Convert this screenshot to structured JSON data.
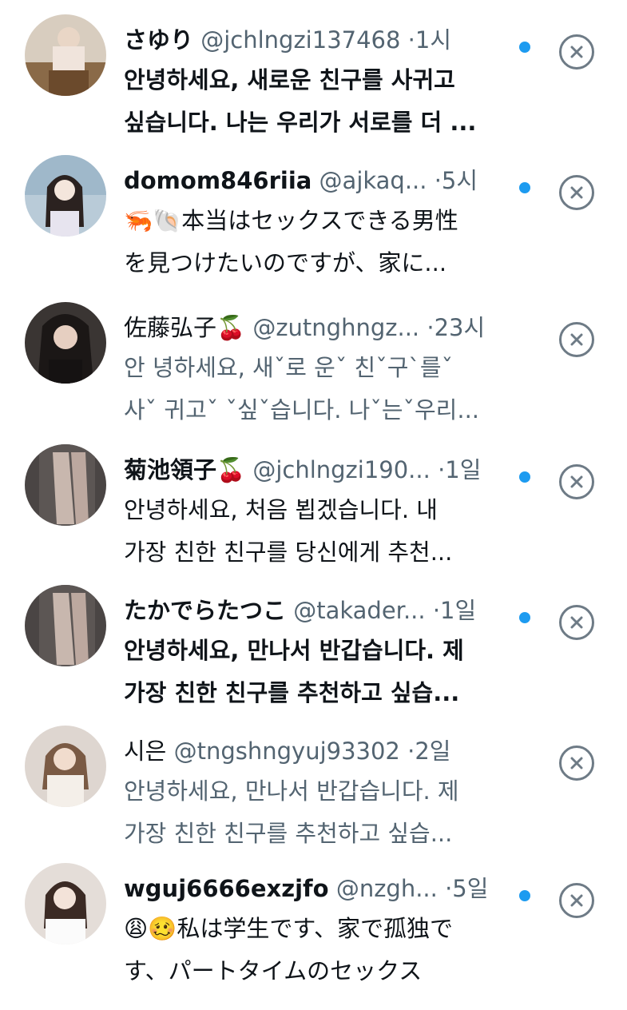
{
  "messages": [
    {
      "name": "さゆり",
      "handle": "@jchlngzi137468",
      "time": "·1시",
      "line1": "안녕하세요, 새로운 친구를 사귀고",
      "line2": "싶습니다. 나는 우리가 서로를 더 ...",
      "unread": true,
      "avatar": "avatar-photo"
    },
    {
      "name": "domom846riia",
      "handle": "@ajkaq...",
      "time": "·5시",
      "line1": "🦐🐚本当はセックスできる男性",
      "line2": "を見つけたいのですが、家に...",
      "unread": true,
      "avatar": "avatar-photo"
    },
    {
      "name": "佐藤弘子🍒",
      "handle": "@zutnghngz...",
      "time": "·23시",
      "line1": "안  녕하세요, 새ˇ로  운ˇ 친ˇ구ˋ를ˇ",
      "line2": "사ˇ 귀고ˇ ˇ싶ˇ습니다. 나ˇ는ˇ우리...",
      "unread": false,
      "avatar": "avatar-photo"
    },
    {
      "name": "菊池領子🍒",
      "handle": "@jchlngzi190...",
      "time": "·1일",
      "line1": "안녕하세요, 처음 뵙겠습니다. 내",
      "line2": "가장 친한 친구를 당신에게 추천...",
      "unread": true,
      "avatar": "avatar-photo"
    },
    {
      "name": "たかでらたつこ",
      "handle": "@takader...",
      "time": "·1일",
      "line1": "안녕하세요, 만나서 반갑습니다. 제",
      "line2": "가장 친한 친구를 추천하고 싶습...",
      "unread": true,
      "avatar": "avatar-photo"
    },
    {
      "name": "시은",
      "handle": "@tngshngyuj93302",
      "time": "·2일",
      "line1": "안녕하세요, 만나서 반갑습니다. 제",
      "line2": "가장 친한 친구를 추천하고 싶습...",
      "unread": false,
      "avatar": "avatar-photo"
    },
    {
      "name": "wguj6666exzjfo",
      "handle": "@nzgh...",
      "time": "·5일",
      "line1": "😩🥴私は学生です、家で孤独で",
      "line2": "す、パートタイムのセックス",
      "unread": true,
      "avatar": "avatar-photo"
    }
  ],
  "colors": {
    "accent": "#1d9bf0",
    "text": "#0f1419",
    "secondary": "#536471"
  }
}
